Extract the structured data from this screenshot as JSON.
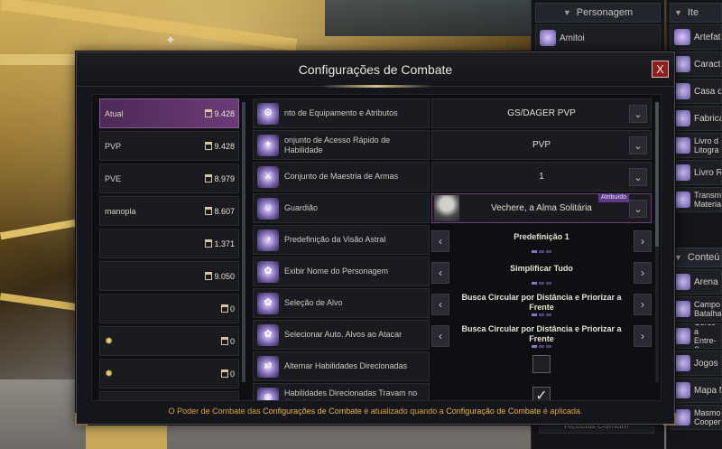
{
  "dialog": {
    "title": "Configurações de Combate",
    "close_glyph": "X",
    "footer_before": "O Poder de Combate das ",
    "footer_hl1": "Configurações de Combate",
    "footer_mid": " é atualizado quando a ",
    "footer_hl2": "Configuração de Combate",
    "footer_after": " é aplicada."
  },
  "presets": [
    {
      "name": "Atual",
      "cp": "9.428",
      "active": true
    },
    {
      "name": "PVP",
      "cp": "9.428"
    },
    {
      "name": "PVE",
      "cp": "8.979"
    },
    {
      "name": "manopla",
      "cp": "8.607"
    },
    {
      "name": "",
      "cp": "1.371"
    },
    {
      "name": "",
      "cp": "9.050"
    },
    {
      "name": "",
      "cp": "0"
    },
    {
      "name": "",
      "cp": "0",
      "star": true
    },
    {
      "name": "",
      "cp": "0",
      "star": true
    },
    {
      "name": "",
      "cp": "0",
      "star": true
    }
  ],
  "settings": [
    {
      "label": "nto de Equipamento e Atributos",
      "control": "dropdown",
      "value": "GS/DAGER PVP",
      "icon": "armor-icon"
    },
    {
      "label": "onjunto de Acesso Rápido de Habilidade",
      "control": "dropdown",
      "value": "PVP",
      "icon": "skill-shortcut-icon"
    },
    {
      "label": "Conjunto de Maestria de Armas",
      "control": "dropdown",
      "value": "1",
      "icon": "weapon-mastery-icon"
    },
    {
      "label": "Guardião",
      "control": "dropdown",
      "value": "Vechere, a Alma Solitária",
      "badge": "Atribuído",
      "icon": "guardian-icon"
    },
    {
      "label": "Predefinição da Visão Astral",
      "control": "stepper",
      "value": "Predefinição 1",
      "icon": "astral-vision-icon"
    },
    {
      "label": "Exibir Nome do Personagem",
      "control": "stepper",
      "value": "Simplificar Tudo",
      "icon": "name-display-icon"
    },
    {
      "label": "Seleção de Alvo",
      "control": "stepper",
      "value": "Busca Circular por Distância e Priorizar a Frente",
      "icon": "target-selection-icon"
    },
    {
      "label": "Selecionar Auto. Alvos ao Atacar",
      "control": "stepper",
      "value": "Busca Circular por Distância e Priorizar a Frente",
      "icon": "auto-target-icon"
    },
    {
      "label": "Alternar Habilidades Direcionadas",
      "control": "checkbox",
      "checked": false,
      "icon": "toggle-skills-icon"
    },
    {
      "label": "Habilidades Direcionadas Travam no Alvo Atual",
      "control": "checkbox",
      "checked": true,
      "icon": "lock-target-icon"
    }
  ],
  "side_panel_1": {
    "header": "Personagem",
    "items": [
      "Amitoi"
    ],
    "footer_item": "Receita Comum"
  },
  "side_panel_2": {
    "header": "Ite",
    "items": [
      "Artefat",
      "Caracte",
      "Casa de",
      "Fabrica",
      "Livro d Litogra",
      "Livro R",
      "Transm Materia"
    ],
    "header2": "Conteú",
    "items2": [
      "Arena",
      "Campo Batalha",
      "Cerco a Entre-S",
      "Jogos d",
      "Mapa M",
      "Masmo Cooper"
    ]
  },
  "colors": {
    "accent_purple": "#6b3b78",
    "footer_orange": "#e0a23a",
    "close_red": "#8e1f1f"
  }
}
